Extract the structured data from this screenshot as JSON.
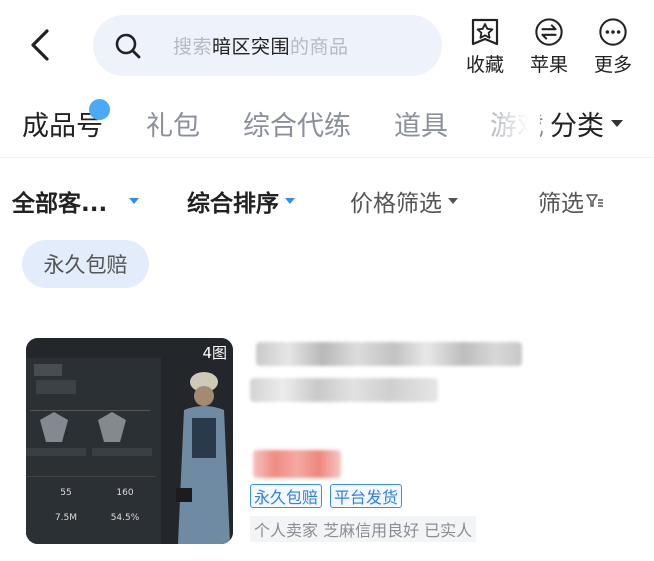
{
  "header": {
    "search": {
      "prefix": "搜索",
      "keyword": "暗区突围",
      "suffix": "的商品"
    },
    "actions": [
      {
        "label": "收藏",
        "icon": "star-bookmark-icon"
      },
      {
        "label": "苹果",
        "icon": "exchange-circle-icon"
      },
      {
        "label": "更多",
        "icon": "more-dots-icon"
      }
    ]
  },
  "categories": {
    "tabs": [
      "成品号",
      "礼包",
      "综合代练",
      "道具",
      "游戏"
    ],
    "active_index": 0,
    "sort_label": "分类"
  },
  "filters": {
    "client": "全部客...",
    "sort": "综合排序",
    "price": "价格筛选",
    "filter": "筛选"
  },
  "quick_chip": "永久包赔",
  "product": {
    "image_count": "4图",
    "stats": [
      "55",
      "160",
      "7.5M",
      "54.5%"
    ],
    "tags": [
      "永久包赔",
      "平台发货"
    ],
    "seller_info": "个人卖家 芝麻信用良好 已实人"
  },
  "colors": {
    "accent_blue": "#2e8df5",
    "search_bg": "#eef3fb",
    "chip_bg": "#e3ecfa",
    "badge_dot": "#4aaaf5"
  }
}
